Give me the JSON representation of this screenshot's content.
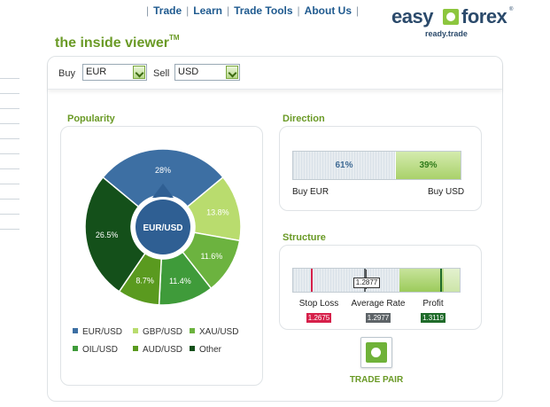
{
  "nav": {
    "links": [
      "Trade",
      "Learn",
      "Trade Tools",
      "About Us"
    ]
  },
  "logo": {
    "easy": "easy",
    "forex": "forex",
    "reg": "®",
    "tagline": "ready.trade"
  },
  "page": {
    "title": "the inside viewer",
    "title_mark": "TM"
  },
  "selector": {
    "buy_label": "Buy",
    "buy_value": "EUR",
    "sell_label": "Sell",
    "sell_value": "USD"
  },
  "popularity": {
    "title": "Popularity",
    "center_label": "EUR/USD"
  },
  "chart_data": {
    "type": "pie",
    "slices": [
      {
        "label": "EUR/USD",
        "value": 28,
        "display": "28%",
        "color": "#3d6fa3"
      },
      {
        "label": "GBP/USD",
        "value": 13.8,
        "display": "13.8%",
        "color": "#b9dc6e"
      },
      {
        "label": "XAU/USD",
        "value": 11.6,
        "display": "11.6%",
        "color": "#6cb33f"
      },
      {
        "label": "OIL/USD",
        "value": 11.4,
        "display": "11.4%",
        "color": "#3f9b3a"
      },
      {
        "label": "AUD/USD",
        "value": 8.7,
        "display": "8.7%",
        "color": "#5a9a1f"
      },
      {
        "label": "Other",
        "value": 26.5,
        "display": "26.5%",
        "color": "#14501a"
      }
    ],
    "legend": [
      "EUR/USD",
      "GBP/USD",
      "XAU/USD",
      "OIL/USD",
      "AUD/USD",
      "Other"
    ]
  },
  "direction": {
    "title": "Direction",
    "buy_pct": 61,
    "buy_text": "61%",
    "sell_pct": 39,
    "sell_text": "39%",
    "buy_label": "Buy EUR",
    "sell_label": "Buy USD"
  },
  "structure": {
    "title": "Structure",
    "current_rate": "1.2877",
    "stop_loss_label": "Stop Loss",
    "stop_loss_value": "1.2675",
    "stop_loss_color": "#d6204a",
    "average_label": "Average Rate",
    "average_value": "1.2977",
    "average_color": "#5e6468",
    "profit_label": "Profit",
    "profit_value": "1.3119",
    "profit_color": "#1f6b2a"
  },
  "trade": {
    "label": "TRADE PAIR"
  }
}
